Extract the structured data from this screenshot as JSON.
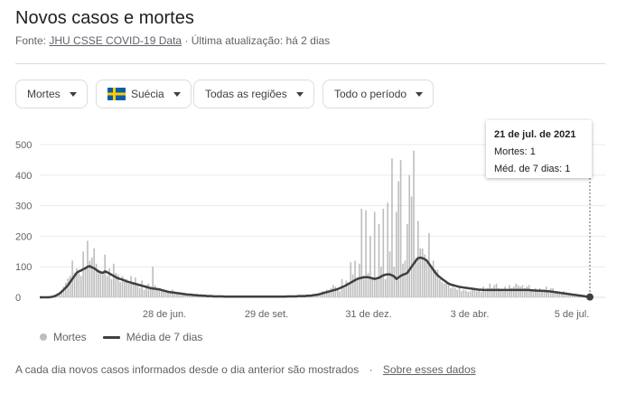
{
  "header": {
    "title": "Novos casos e mortes",
    "source_prefix": "Fonte:",
    "source_link": "JHU CSSE COVID-19 Data",
    "source_suffix": "· Última atualização: há 2 dias"
  },
  "filters": {
    "metric": "Mortes",
    "country": "Suécia",
    "region": "Todas as regiões",
    "period": "Todo o período"
  },
  "colors": {
    "bars": "#bdbdbd",
    "avg_line": "#3c4043",
    "grid": "#e8eaed",
    "flag_blue": "#0a5ea8",
    "flag_yellow": "#fecc00"
  },
  "icons": [
    "chevron-down-icon",
    "sweden-flag-icon"
  ],
  "tooltip": {
    "date": "21 de jul. de 2021",
    "deaths": "Mortes: 1",
    "avg": "Méd. de 7 dias: 1"
  },
  "legend": {
    "bars_label": "Mortes",
    "line_label": "Média de 7 dias"
  },
  "footnote": {
    "text": "A cada dia novos casos informados desde o dia anterior são mostrados",
    "link": "Sobre esses dados"
  },
  "chart_data": {
    "type": "bar",
    "title": "",
    "ylim": [
      0,
      500
    ],
    "y_ticks": [
      0,
      100,
      200,
      300,
      400,
      500
    ],
    "x_tick_labels": [
      "28 de jun.",
      "29 de set.",
      "31 de dez.",
      "3 de abr.",
      "5 de jul."
    ],
    "grid": true,
    "series": [
      {
        "name": "Mortes",
        "render": "bars",
        "values": [
          0,
          0,
          0,
          0,
          0,
          0,
          0,
          2,
          5,
          12,
          20,
          35,
          48,
          62,
          70,
          120,
          80,
          95,
          78,
          70,
          150,
          100,
          185,
          120,
          130,
          160,
          110,
          90,
          85,
          75,
          140,
          70,
          95,
          60,
          110,
          80,
          75,
          50,
          70,
          55,
          60,
          45,
          70,
          50,
          65,
          40,
          30,
          55,
          25,
          40,
          45,
          35,
          100,
          40,
          30,
          28,
          22,
          18,
          20,
          15,
          18,
          25,
          15,
          12,
          10,
          14,
          10,
          8,
          12,
          10,
          8,
          7,
          5,
          6,
          4,
          5,
          4,
          3,
          4,
          3,
          4,
          2,
          3,
          2,
          3,
          2,
          3,
          2,
          2,
          3,
          2,
          2,
          2,
          1,
          2,
          2,
          1,
          2,
          1,
          2,
          2,
          1,
          2,
          1,
          1,
          2,
          2,
          1,
          2,
          1,
          2,
          1,
          2,
          2,
          3,
          2,
          3,
          2,
          3,
          4,
          3,
          5,
          4,
          4,
          5,
          8,
          10,
          8,
          12,
          15,
          20,
          18,
          25,
          22,
          30,
          40,
          35,
          25,
          20,
          60,
          30,
          55,
          40,
          115,
          75,
          120,
          60,
          110,
          290,
          70,
          285,
          80,
          200,
          60,
          280,
          60,
          240,
          100,
          290,
          60,
          310,
          150,
          455,
          100,
          280,
          380,
          450,
          110,
          120,
          240,
          400,
          330,
          480,
          130,
          250,
          160,
          160,
          140,
          120,
          210,
          100,
          120,
          90,
          90,
          60,
          50,
          45,
          55,
          40,
          30,
          35,
          30,
          25,
          30,
          20,
          25,
          22,
          18,
          20,
          25,
          30,
          20,
          25,
          18,
          35,
          20,
          30,
          45,
          30,
          40,
          45,
          30,
          25,
          20,
          35,
          20,
          40,
          30,
          35,
          45,
          40,
          35,
          40,
          30,
          35,
          40,
          25,
          20,
          30,
          25,
          30,
          20,
          25,
          35,
          20,
          30,
          30,
          20,
          15,
          15,
          12,
          20,
          10,
          10,
          8,
          8,
          5,
          5,
          5,
          4,
          3,
          2,
          2,
          1
        ]
      },
      {
        "name": "Média de 7 dias",
        "render": "line",
        "values": [
          0,
          0,
          0,
          0,
          0,
          1,
          2,
          4,
          8,
          12,
          18,
          25,
          32,
          40,
          50,
          60,
          70,
          80,
          85,
          88,
          92,
          95,
          100,
          102,
          98,
          95,
          90,
          85,
          82,
          80,
          85,
          82,
          78,
          74,
          70,
          66,
          62,
          60,
          58,
          55,
          52,
          50,
          48,
          46,
          44,
          42,
          40,
          38,
          36,
          34,
          32,
          30,
          29,
          28,
          27,
          26,
          24,
          22,
          20,
          18,
          17,
          16,
          15,
          14,
          13,
          12,
          11,
          10,
          9,
          9,
          8,
          7,
          7,
          6,
          6,
          5,
          5,
          4,
          4,
          4,
          3,
          3,
          3,
          3,
          3,
          2,
          2,
          2,
          2,
          2,
          2,
          2,
          2,
          2,
          2,
          2,
          2,
          2,
          2,
          2,
          2,
          2,
          2,
          2,
          2,
          2,
          2,
          2,
          2,
          2,
          2,
          2,
          2,
          2,
          3,
          3,
          3,
          3,
          3,
          4,
          4,
          4,
          4,
          5,
          5,
          6,
          7,
          8,
          9,
          11,
          13,
          15,
          17,
          19,
          21,
          23,
          25,
          27,
          30,
          33,
          36,
          40,
          44,
          48,
          52,
          56,
          60,
          62,
          64,
          66,
          66,
          66,
          64,
          62,
          60,
          62,
          64,
          68,
          72,
          74,
          75,
          75,
          72,
          68,
          60,
          65,
          70,
          74,
          76,
          80,
          90,
          100,
          110,
          120,
          128,
          130,
          128,
          125,
          120,
          110,
          100,
          90,
          80,
          72,
          66,
          60,
          55,
          50,
          45,
          42,
          40,
          38,
          36,
          34,
          33,
          32,
          31,
          30,
          29,
          28,
          27,
          26,
          25,
          25,
          24,
          24,
          24,
          24,
          24,
          24,
          24,
          24,
          24,
          24,
          24,
          24,
          24,
          24,
          24,
          24,
          24,
          24,
          24,
          24,
          24,
          24,
          23,
          23,
          22,
          22,
          22,
          21,
          21,
          20,
          20,
          19,
          18,
          17,
          16,
          15,
          14,
          13,
          12,
          11,
          10,
          9,
          8,
          7,
          6,
          5,
          4,
          3,
          2,
          1
        ]
      }
    ]
  }
}
